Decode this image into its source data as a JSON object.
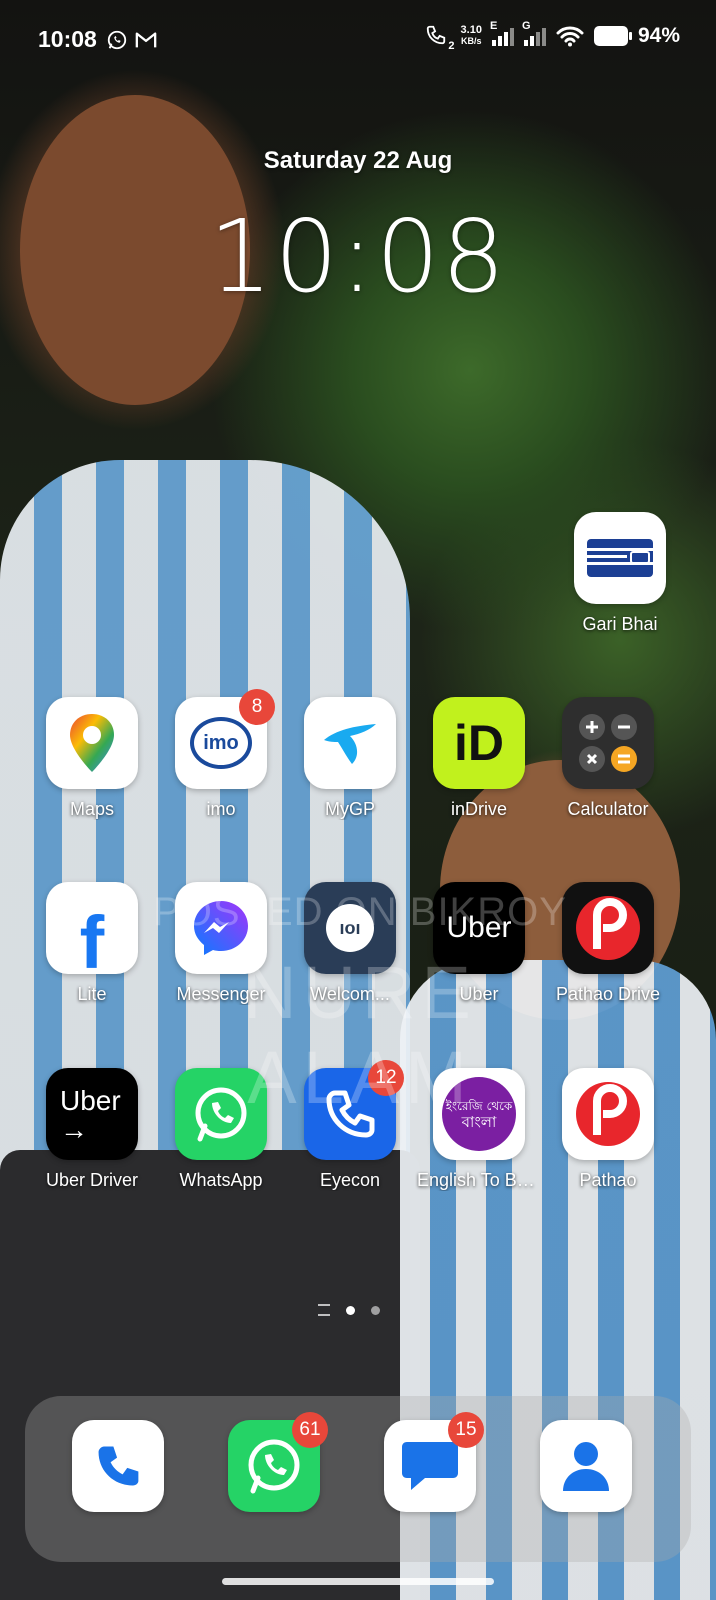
{
  "status_bar": {
    "time": "10:08",
    "network_speed_value": "3.10",
    "network_speed_unit": "KB/s",
    "sim1_type": "E",
    "sim2_type": "G",
    "call_sim": "2",
    "battery": "94%",
    "notification_icons": [
      "whatsapp-icon",
      "gmail-icon"
    ]
  },
  "lockclock": {
    "date": "Saturday 22 Aug",
    "time": "10:08"
  },
  "apps": {
    "gari_bhai": {
      "label": "Gari Bhai"
    },
    "maps": {
      "label": "Maps"
    },
    "imo": {
      "label": "imo",
      "badge": "8",
      "logo": "imo"
    },
    "mygp": {
      "label": "MyGP"
    },
    "indrive": {
      "label": "inDrive",
      "logo": "iD"
    },
    "calculator": {
      "label": "Calculator"
    },
    "lite": {
      "label": "Lite",
      "logo": "f"
    },
    "messenger": {
      "label": "Messenger"
    },
    "welcome": {
      "label": "Welcom...",
      "logo": "ıoı"
    },
    "uber": {
      "label": "Uber",
      "logo": "Uber"
    },
    "pathao_drive": {
      "label": "Pathao Drive"
    },
    "uber_driver": {
      "label": "Uber Driver",
      "logo": "Uber",
      "arrow": "→"
    },
    "whatsapp": {
      "label": "WhatsApp"
    },
    "eyecon": {
      "label": "Eyecon",
      "badge": "12"
    },
    "english_to_bangla": {
      "label": "English To Ba...",
      "logo_line1": "ইংরেজি থেকে",
      "logo_line2": "বাংলা"
    },
    "pathao": {
      "label": "Pathao"
    }
  },
  "watermark": {
    "line1": "POSTED ON BIKROY",
    "line2": "NURE ALAM"
  },
  "dock": {
    "phone": {
      "icon": "phone-icon"
    },
    "whatsapp": {
      "icon": "whatsapp-icon",
      "badge": "61"
    },
    "messages": {
      "icon": "messages-icon",
      "badge": "15"
    },
    "contacts": {
      "icon": "contacts-icon"
    }
  },
  "colors": {
    "badge": "#e8473a",
    "indrive": "#c1f11d",
    "whatsapp": "#25d366",
    "eyecon": "#1a66e8",
    "pathao": "#e8262c"
  }
}
